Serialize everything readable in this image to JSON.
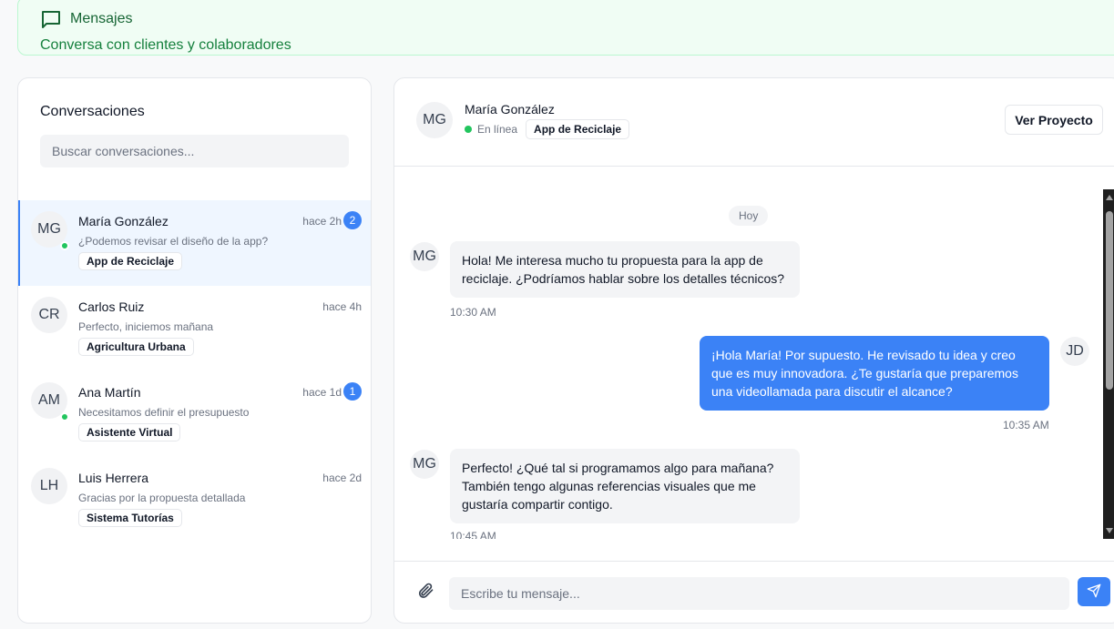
{
  "header": {
    "title": "Mensajes",
    "subtitle": "Conversa con clientes y colaboradores"
  },
  "sidebar": {
    "title": "Conversaciones",
    "search_placeholder": "Buscar conversaciones...",
    "conversations": [
      {
        "initials": "MG",
        "name": "María González",
        "time": "hace 2h",
        "unread": "2",
        "preview": "¿Podemos revisar el diseño de la app?",
        "project": "App de Reciclaje",
        "online": true,
        "active": true
      },
      {
        "initials": "CR",
        "name": "Carlos Ruiz",
        "time": "hace 4h",
        "unread": "",
        "preview": "Perfecto, iniciemos mañana",
        "project": "Agricultura Urbana",
        "online": false,
        "active": false
      },
      {
        "initials": "AM",
        "name": "Ana Martín",
        "time": "hace 1d",
        "unread": "1",
        "preview": "Necesitamos definir el presupuesto",
        "project": "Asistente Virtual",
        "online": true,
        "active": false
      },
      {
        "initials": "LH",
        "name": "Luis Herrera",
        "time": "hace 2d",
        "unread": "",
        "preview": "Gracias por la propuesta detallada",
        "project": "Sistema Tutorías",
        "online": false,
        "active": false
      }
    ]
  },
  "chat": {
    "contact": {
      "initials": "MG",
      "name": "María González",
      "status": "En línea",
      "project": "App de Reciclaje"
    },
    "view_project_label": "Ver Proyecto",
    "day_label": "Hoy",
    "messages": [
      {
        "from": "MG",
        "text": "Hola! Me interesa mucho tu propuesta para la app de reciclaje. ¿Podríamos hablar sobre los detalles técnicos?",
        "time": "10:30 AM"
      },
      {
        "from": "JD",
        "text": "¡Hola María! Por supuesto. He revisado tu idea y creo que es muy innovadora. ¿Te gustaría que preparemos una videollamada para discutir el alcance?",
        "time": "10:35 AM"
      },
      {
        "from": "MG",
        "text": "Perfecto! ¿Qué tal si programamos algo para mañana? También tengo algunas referencias visuales que me gustaría compartir contigo.",
        "time": "10:45 AM"
      }
    ],
    "input_placeholder": "Escribe tu mensaje..."
  },
  "colors": {
    "accent": "#3b82f6",
    "online": "#22c55e",
    "banner_bg": "#f0fdf4",
    "banner_text": "#166534"
  }
}
